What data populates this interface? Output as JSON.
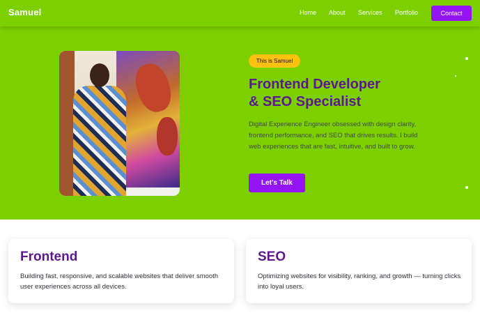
{
  "navbar": {
    "brand": "Samuel",
    "links": [
      {
        "label": "Home"
      },
      {
        "label": "About"
      },
      {
        "label": "Services"
      },
      {
        "label": "Portfolio"
      }
    ],
    "contact_label": "Contact"
  },
  "hero": {
    "badge": "This is Samuel",
    "headline_line1": "Frontend Developer",
    "headline_line2": "& SEO Specialist",
    "description": "Digital Experience Engineer obsessed with design clarity, frontend performance, and SEO that drives results. I build web experiences that are fast, intuitive, and built to grow.",
    "cta_label": "Let's Talk"
  },
  "services": [
    {
      "title": "Frontend",
      "text": "Building fast, responsive, and scalable websites that deliver smooth user experiences across all devices."
    },
    {
      "title": "SEO",
      "text": "Optimizing websites for visibility, ranking, and growth — turning clicks into loyal users."
    }
  ],
  "colors": {
    "hero_green": "#7dd000",
    "accent_purple": "#9414f5",
    "headline_purple": "#5a1a8e",
    "badge_yellow": "#ffc20e"
  }
}
